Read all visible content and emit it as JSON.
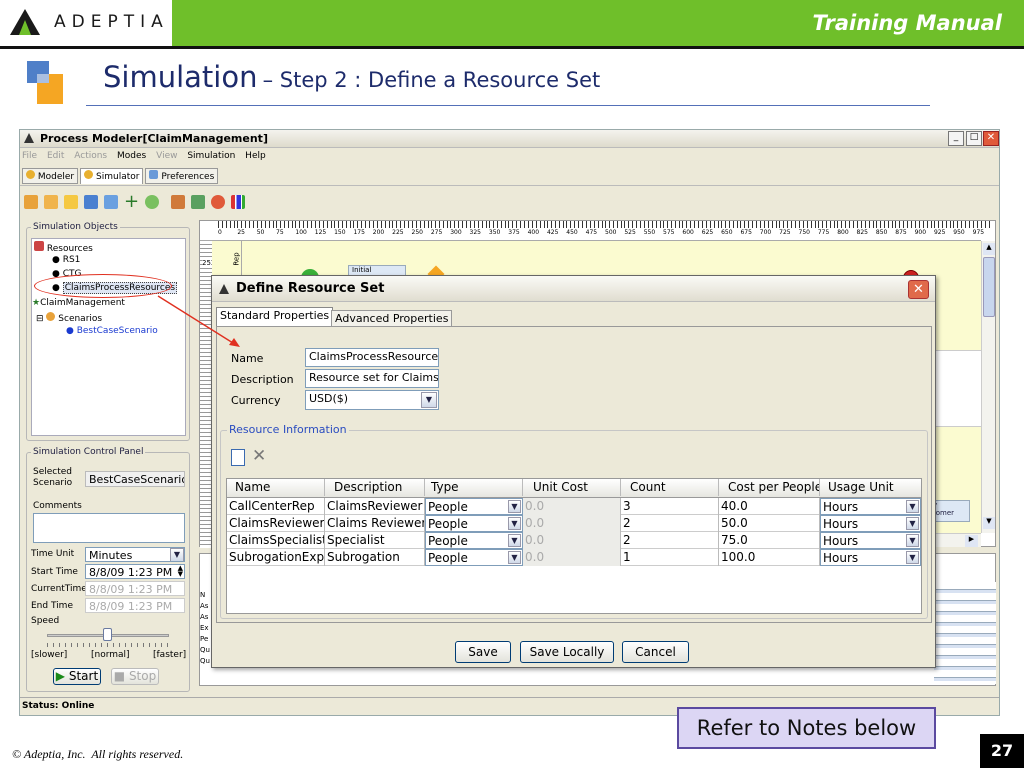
{
  "slide": {
    "logo_text": "ADEPTIA",
    "header_right": "Training Manual",
    "title_main": "Simulation",
    "title_sub": "– Step 2 : Define a Resource Set",
    "callout": "Refer to Notes below",
    "footer": "© Adeptia, Inc.  All rights reserved.",
    "page": "27"
  },
  "app": {
    "title": "Process Modeler[ClaimManagement]",
    "menu": [
      "File",
      "Edit",
      "Actions",
      "Modes",
      "View",
      "Simulation",
      "Help"
    ],
    "tabs": [
      "Modeler",
      "Simulator",
      "Preferences"
    ],
    "objects_panel": {
      "title": "Simulation Objects",
      "items": [
        "Resources",
        "RS1",
        "CTG",
        "ClaimsProcessResources",
        "ClaimManagement",
        "Scenarios",
        "BestCaseScenario"
      ]
    },
    "control_panel": {
      "title": "Simulation Control Panel",
      "selected_scenario_label": "Selected Scenario",
      "selected_scenario": "BestCaseScenario",
      "comments_label": "Comments",
      "time_unit_label": "Time Unit",
      "time_unit": "Minutes",
      "start_time_label": "Start Time",
      "start_time": "8/8/09 1:23 PM",
      "current_time_label": "CurrentTime",
      "current_time": "8/8/09 1:23 PM",
      "end_time_label": "End Time",
      "end_time": "8/8/09 1:23 PM",
      "speed_label": "Speed",
      "speed_slower": "[slower]",
      "speed_normal": "[normal]",
      "speed_faster": "[faster]",
      "start_btn": "Start",
      "stop_btn": "Stop"
    },
    "status": "Status: Online",
    "ruler": [
      "0",
      "25",
      "50",
      "75",
      "100",
      "125",
      "150",
      "175",
      "200",
      "225",
      "250",
      "275",
      "300",
      "325",
      "350",
      "375",
      "400",
      "425",
      "450",
      "475",
      "500",
      "525",
      "550",
      "575",
      "600",
      "625",
      "650",
      "675",
      "700",
      "725",
      "750",
      "775",
      "800",
      "825",
      "850",
      "875",
      "900",
      "925",
      "950",
      "975"
    ],
    "canvas": {
      "node_initial": "Initial",
      "lane_label": "Rep",
      "node_right": "y\ntomer",
      "left_ruler_25": "25"
    },
    "bottom_left_stubs": [
      "N",
      "As",
      "As",
      "Ex",
      "Pe",
      "Qu",
      "Qu"
    ]
  },
  "dialog": {
    "title": "Define Resource Set",
    "tabs": [
      "Standard Properties",
      "Advanced Properties"
    ],
    "name_label": "Name",
    "name_value": "ClaimsProcessResources",
    "desc_label": "Description",
    "desc_value": "Resource set for Claims F",
    "currency_label": "Currency",
    "currency_value": "USD($)",
    "group_title": "Resource Information",
    "columns": [
      "Name",
      "Description",
      "Type",
      "Unit Cost",
      "Count",
      "Cost per People",
      "Usage Unit"
    ],
    "rows": [
      [
        "CallCenterRep",
        "ClaimsReviewer",
        "People",
        "0.0",
        "3",
        "40.0",
        "Hours"
      ],
      [
        "ClaimsReviewer",
        "Claims Reviewer",
        "People",
        "0.0",
        "2",
        "50.0",
        "Hours"
      ],
      [
        "ClaimsSpecialist",
        "Specialist",
        "People",
        "0.0",
        "2",
        "75.0",
        "Hours"
      ],
      [
        "SubrogationExpert",
        "Subrogation",
        "People",
        "0.0",
        "1",
        "100.0",
        "Hours"
      ]
    ],
    "save": "Save",
    "save_locally": "Save Locally",
    "cancel": "Cancel"
  },
  "colors": {
    "brand_green": "#6fbf2a",
    "accent_red": "#e03020",
    "titlebar": "#ece9d8",
    "callout_border": "#5b4aa0"
  }
}
